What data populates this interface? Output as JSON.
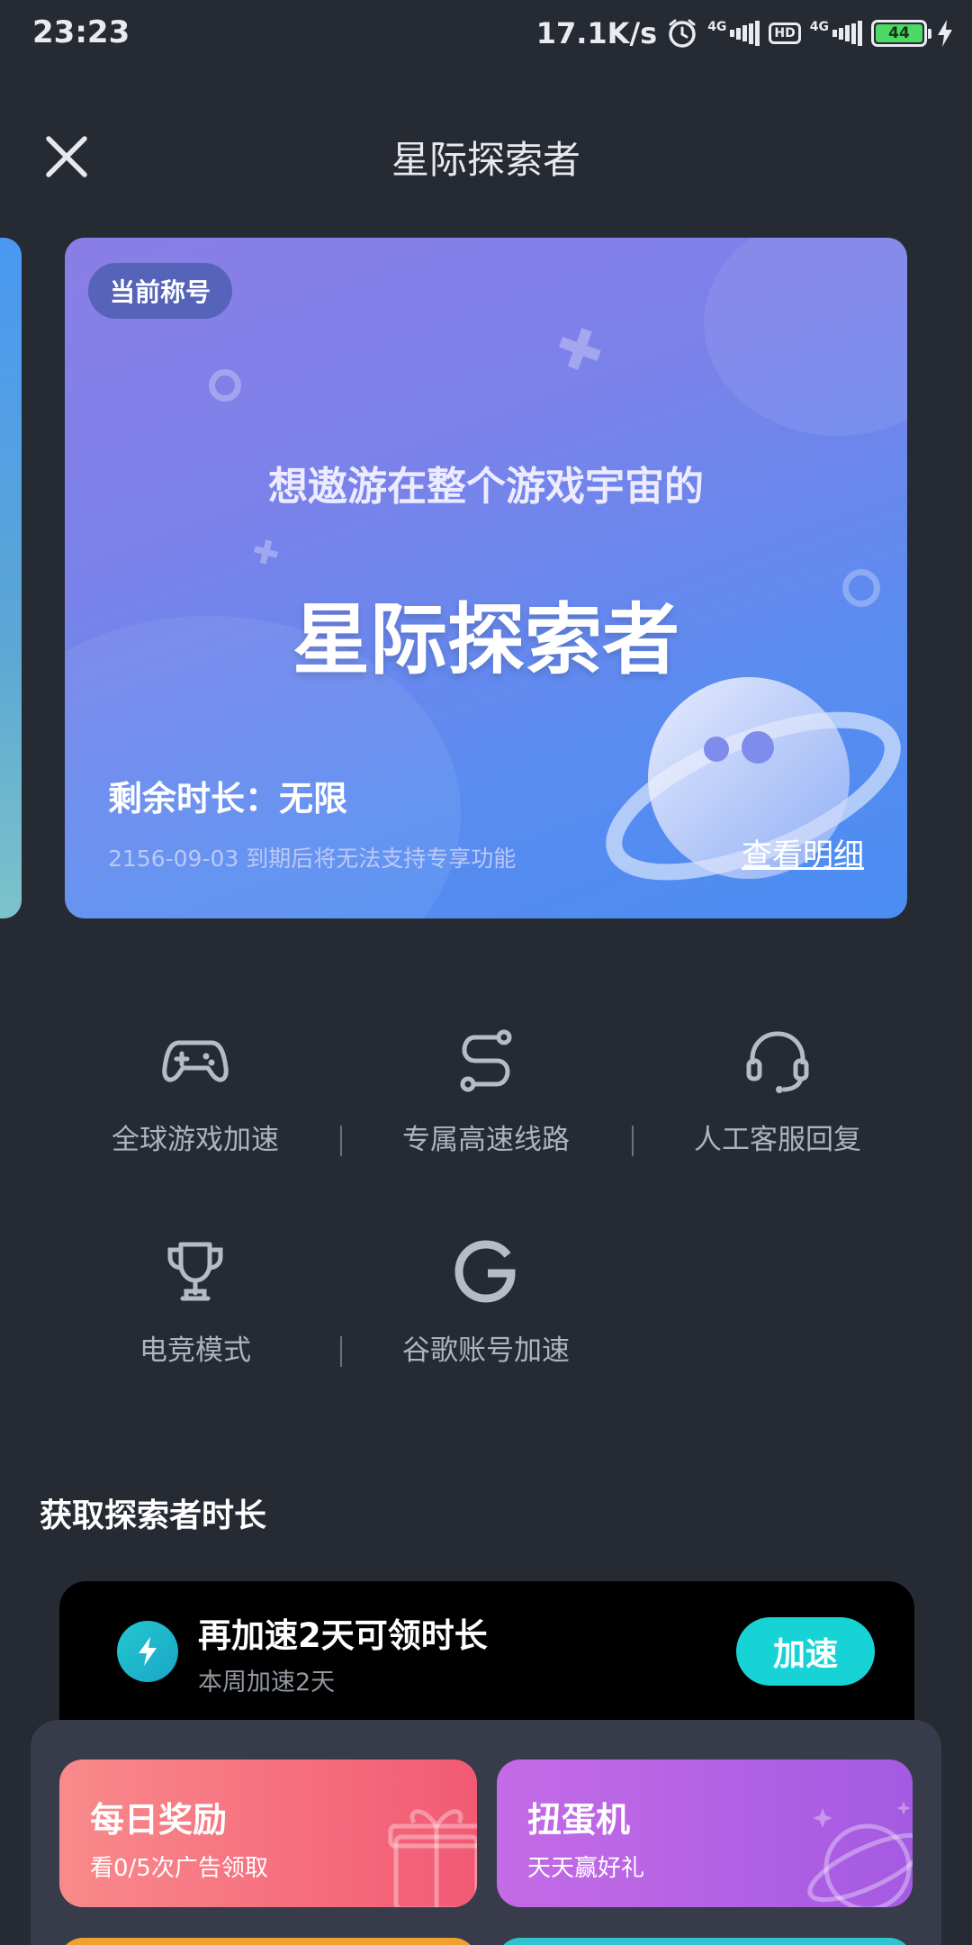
{
  "status_bar": {
    "time": "23:23",
    "network_speed": "17.1K/s",
    "signal1_tag": "4G",
    "hd": "HD",
    "signal2_tag": "4G",
    "battery": "44"
  },
  "header": {
    "title": "星际探索者",
    "close_icon": "close-icon"
  },
  "card": {
    "badge": "当前称号",
    "subtitle": "想遨游在整个游戏宇宙的",
    "title": "星际探索者",
    "remaining": "剩余时长：无限",
    "expire_note": "2156-09-03 到期后将无法支持专享功能",
    "detail_link": "查看明细"
  },
  "features": [
    {
      "icon": "gamepad-icon",
      "label": "全球游戏加速"
    },
    {
      "icon": "route-icon",
      "label": "专属高速线路"
    },
    {
      "icon": "headset-icon",
      "label": "人工客服回复"
    },
    {
      "icon": "trophy-icon",
      "label": "电竞模式"
    },
    {
      "icon": "google-icon",
      "label": "谷歌账号加速"
    }
  ],
  "section": {
    "title": "获取探索者时长"
  },
  "task": {
    "icon": "lightning-icon",
    "title": "再加速2天可领时长",
    "subtitle": "本周加速2天",
    "button": "加速"
  },
  "promos": [
    {
      "title": "每日奖励",
      "subtitle": "看0/5次广告领取",
      "color": "#f25a74",
      "icon": "gift-icon"
    },
    {
      "title": "扭蛋机",
      "subtitle": "天天赢好礼",
      "color": "#a45ae2",
      "icon": "planet-icon"
    }
  ],
  "colors": {
    "background": "#262a33",
    "accent": "#17d3d6",
    "card_start": "#8a7ee6",
    "card_end": "#4b8df2"
  }
}
